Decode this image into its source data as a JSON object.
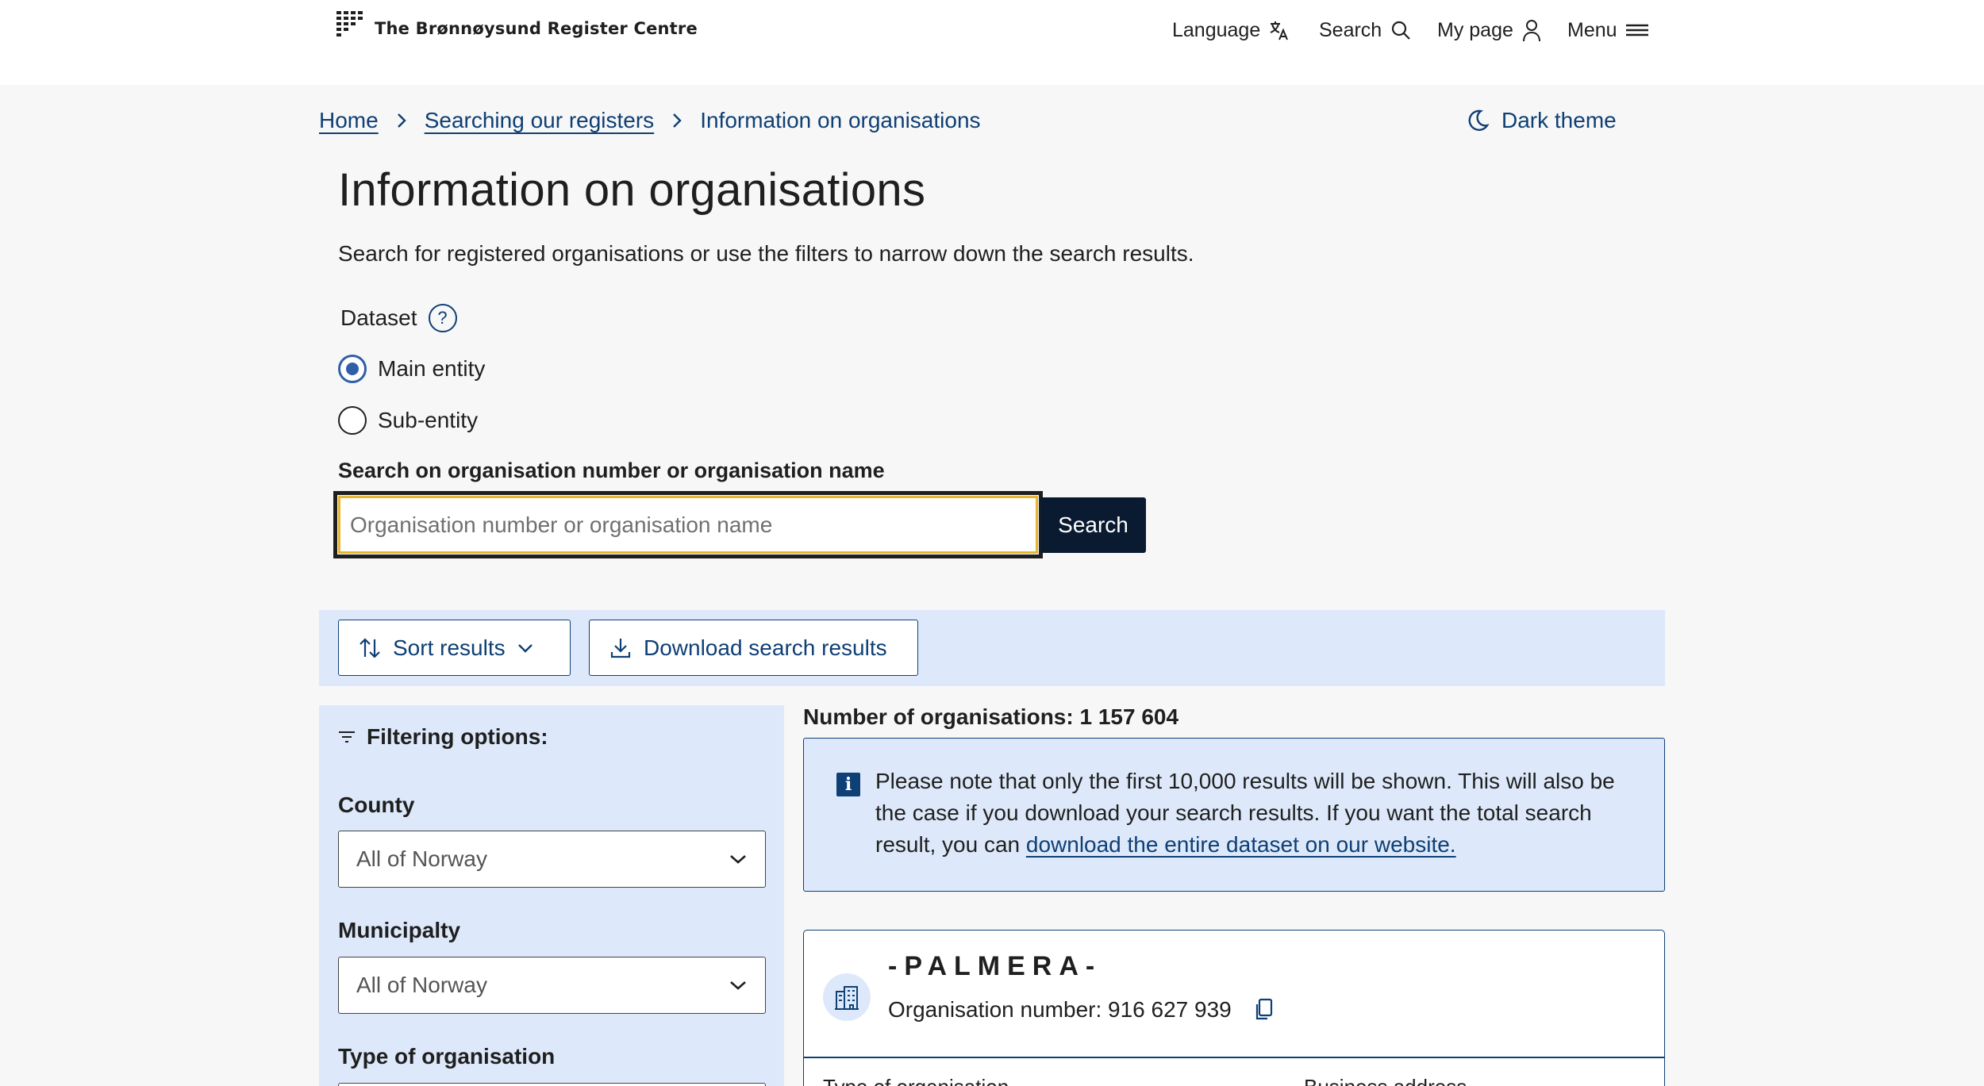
{
  "header": {
    "logo_text": "The Brønnøysund Register Centre",
    "nav": {
      "language": "Language",
      "search": "Search",
      "my_page": "My page",
      "menu": "Menu"
    }
  },
  "breadcrumb": {
    "items": [
      "Home",
      "Searching our registers",
      "Information on organisations"
    ]
  },
  "theme_toggle": "Dark theme",
  "page": {
    "title": "Information on organisations",
    "intro": "Search for registered organisations or use the filters to narrow down the search results."
  },
  "dataset": {
    "label": "Dataset",
    "help": "?",
    "options": [
      {
        "label": "Main entity",
        "checked": true
      },
      {
        "label": "Sub-entity",
        "checked": false
      }
    ]
  },
  "search": {
    "label": "Search on organisation number or organisation name",
    "placeholder": "Organisation number or organisation name",
    "value": "",
    "button": "Search"
  },
  "toolbar": {
    "sort": "Sort results",
    "download": "Download search results"
  },
  "filters": {
    "title": "Filtering options:",
    "county": {
      "label": "County",
      "value": "All of Norway"
    },
    "municipality": {
      "label": "Municipalty",
      "value": "All of Norway"
    },
    "org_type": {
      "label": "Type of organisation"
    }
  },
  "results": {
    "count": "Number of organisations: 1 157 604",
    "notice_text": "Please note that only the first 10,000 results will be shown. This will also be the case if you download your search results. If you want the total search result, you can ",
    "notice_link": "download the entire dataset on our website.",
    "card": {
      "name": "-PALMERA-",
      "org_number": "Organisation number: 916 627 939",
      "col1": "Type of organisation",
      "col2": "Business address"
    }
  },
  "colors": {
    "link_blue": "#0e3f75",
    "panel_blue": "#dde9fa",
    "button_dark": "#0a1b31",
    "focus_yellow": "#e7b52e"
  }
}
